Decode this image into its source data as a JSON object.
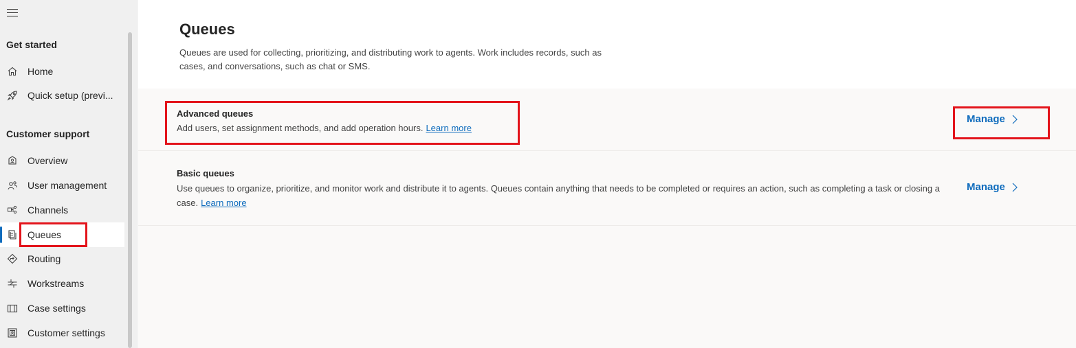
{
  "sidebar": {
    "sections": [
      {
        "title": "Get started",
        "items": [
          {
            "label": "Home",
            "icon": "home-icon"
          },
          {
            "label": "Quick setup (previ...",
            "icon": "rocket-icon"
          }
        ]
      },
      {
        "title": "Customer support",
        "items": [
          {
            "label": "Overview",
            "icon": "overview-icon"
          },
          {
            "label": "User management",
            "icon": "people-icon"
          },
          {
            "label": "Channels",
            "icon": "channels-icon"
          },
          {
            "label": "Queues",
            "icon": "queues-icon",
            "selected": true
          },
          {
            "label": "Routing",
            "icon": "routing-icon"
          },
          {
            "label": "Workstreams",
            "icon": "workstreams-icon"
          },
          {
            "label": "Case settings",
            "icon": "case-settings-icon"
          },
          {
            "label": "Customer settings",
            "icon": "customer-settings-icon"
          }
        ]
      }
    ]
  },
  "main": {
    "title": "Queues",
    "description": "Queues are used for collecting, prioritizing, and distributing work to agents. Work includes records, such as cases, and conversations, such as chat or SMS.",
    "cards": [
      {
        "title": "Advanced queues",
        "description": "Add users, set assignment methods, and add operation hours.",
        "link": "Learn more",
        "action": "Manage"
      },
      {
        "title": "Basic queues",
        "description": "Use queues to organize, prioritize, and monitor work and distribute it to agents. Queues contain anything that needs to be completed or requires an action, such as completing a task or closing a case.",
        "link": "Learn more",
        "action": "Manage"
      }
    ]
  },
  "colors": {
    "accent": "#0f6cbd",
    "highlight_box": "#e3141b",
    "sidebar_bg": "#f0f0f0",
    "panel_bg": "#faf9f8"
  }
}
